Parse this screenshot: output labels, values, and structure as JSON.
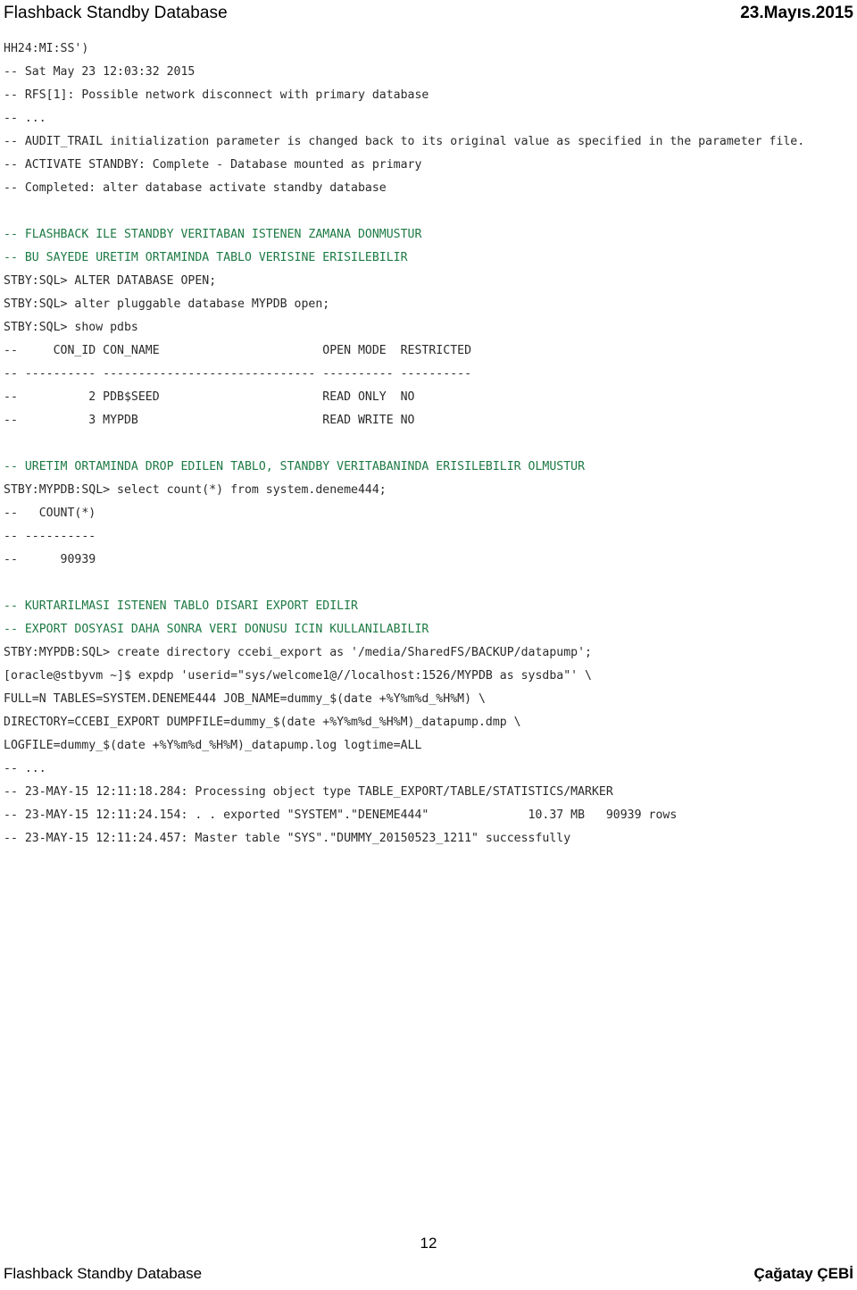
{
  "header": {
    "title": "Flashback Standby Database",
    "date": "23.Mayıs.2015"
  },
  "footer": {
    "page_number": "12",
    "title": "Flashback Standby Database",
    "author": "Çağatay ÇEBİ"
  },
  "colors": {
    "text": "#2a2a2a",
    "comment_tr": "#1d7a44",
    "background": "#ffffff"
  },
  "content": {
    "lines": [
      {
        "id": "l01",
        "style": "code",
        "text": "HH24:MI:SS')"
      },
      {
        "id": "l02",
        "style": "code",
        "text": "-- Sat May 23 12:03:32 2015"
      },
      {
        "id": "l03",
        "style": "code",
        "text": "-- RFS[1]: Possible network disconnect with primary database"
      },
      {
        "id": "l04",
        "style": "code",
        "text": "-- ..."
      },
      {
        "id": "l05",
        "style": "code",
        "text": "-- AUDIT_TRAIL initialization parameter is changed back to its original value as specified in the parameter file."
      },
      {
        "id": "l06",
        "style": "code",
        "text": "-- ACTIVATE STANDBY: Complete - Database mounted as primary"
      },
      {
        "id": "l07",
        "style": "code",
        "text": "-- Completed: alter database activate standby database"
      },
      {
        "id": "l08",
        "style": "gap-lg",
        "text": ""
      },
      {
        "id": "l09",
        "style": "comment",
        "text": "-- FLASHBACK ILE STANDBY VERITABAN ISTENEN ZAMANA DONMUSTUR"
      },
      {
        "id": "l10",
        "style": "comment",
        "text": "-- BU SAYEDE URETIM ORTAMINDA TABLO VERISINE ERISILEBILIR"
      },
      {
        "id": "l11",
        "style": "code",
        "text": "STBY:SQL> ALTER DATABASE OPEN;"
      },
      {
        "id": "l12",
        "style": "code",
        "text": "STBY:SQL> alter pluggable database MYPDB open;"
      },
      {
        "id": "l13",
        "style": "code",
        "text": "STBY:SQL> show pdbs"
      },
      {
        "id": "l14",
        "style": "code",
        "text": "--     CON_ID CON_NAME                       OPEN MODE  RESTRICTED"
      },
      {
        "id": "l15",
        "style": "code",
        "text": "-- ---------- ------------------------------ ---------- ----------"
      },
      {
        "id": "l16",
        "style": "code",
        "text": "--          2 PDB$SEED                       READ ONLY  NO"
      },
      {
        "id": "l17",
        "style": "code",
        "text": "--          3 MYPDB                          READ WRITE NO"
      },
      {
        "id": "l18",
        "style": "gap-lg",
        "text": ""
      },
      {
        "id": "l19",
        "style": "comment",
        "text": "-- URETIM ORTAMINDA DROP EDILEN TABLO, STANDBY VERITABANINDA ERISILEBILIR OLMUSTUR"
      },
      {
        "id": "l20",
        "style": "code",
        "text": "STBY:MYPDB:SQL> select count(*) from system.deneme444;"
      },
      {
        "id": "l21",
        "style": "code",
        "text": "--   COUNT(*)"
      },
      {
        "id": "l22",
        "style": "code",
        "text": "-- ----------"
      },
      {
        "id": "l23",
        "style": "code",
        "text": "--      90939"
      },
      {
        "id": "l24",
        "style": "gap-lg",
        "text": ""
      },
      {
        "id": "l25",
        "style": "comment",
        "text": "-- KURTARILMASI ISTENEN TABLO DISARI EXPORT EDILIR"
      },
      {
        "id": "l26",
        "style": "comment",
        "text": "-- EXPORT DOSYASI DAHA SONRA VERI DONUSU ICIN KULLANILABILIR"
      },
      {
        "id": "l27",
        "style": "code",
        "text": "STBY:MYPDB:SQL> create directory ccebi_export as '/media/SharedFS/BACKUP/datapump';"
      },
      {
        "id": "l28",
        "style": "code",
        "text": "[oracle@stbyvm ~]$ expdp 'userid=\"sys/welcome1@//localhost:1526/MYPDB as sysdba\"' \\"
      },
      {
        "id": "l29",
        "style": "code",
        "text": "FULL=N TABLES=SYSTEM.DENEME444 JOB_NAME=dummy_$(date +%Y%m%d_%H%M) \\"
      },
      {
        "id": "l30",
        "style": "code",
        "text": "DIRECTORY=CCEBI_EXPORT DUMPFILE=dummy_$(date +%Y%m%d_%H%M)_datapump.dmp \\"
      },
      {
        "id": "l31",
        "style": "code",
        "text": "LOGFILE=dummy_$(date +%Y%m%d_%H%M)_datapump.log logtime=ALL"
      },
      {
        "id": "l32",
        "style": "code",
        "text": "-- ..."
      },
      {
        "id": "l33",
        "style": "code",
        "text": "-- 23-MAY-15 12:11:18.284: Processing object type TABLE_EXPORT/TABLE/STATISTICS/MARKER"
      },
      {
        "id": "l34",
        "style": "code",
        "text": "-- 23-MAY-15 12:11:24.154: . . exported \"SYSTEM\".\"DENEME444\"              10.37 MB   90939 rows"
      },
      {
        "id": "l35",
        "style": "code",
        "text": "-- 23-MAY-15 12:11:24.457: Master table \"SYS\".\"DUMMY_20150523_1211\" successfully"
      }
    ]
  }
}
